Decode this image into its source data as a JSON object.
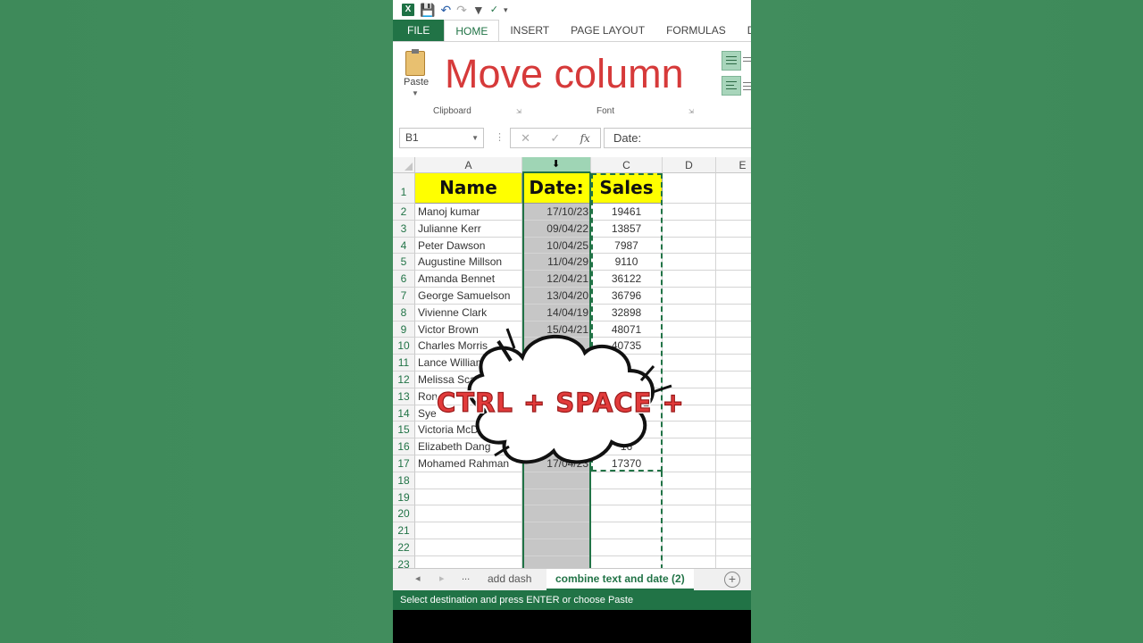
{
  "qat": {
    "logo": "X",
    "icons": [
      "save-icon",
      "undo-icon",
      "redo-icon",
      "filter-icon",
      "spellcheck-icon",
      "customize-icon"
    ]
  },
  "ribbon_tabs": [
    "FILE",
    "HOME",
    "INSERT",
    "PAGE LAYOUT",
    "FORMULAS",
    "DATA"
  ],
  "ribbon": {
    "paste_label": "Paste",
    "title": "Move column",
    "clipboard_label": "Clipboard",
    "font_label": "Font"
  },
  "formula_bar": {
    "name_box": "B1",
    "fx": "fx",
    "value": "Date:"
  },
  "columns": [
    "A",
    "B",
    "C",
    "D",
    "E"
  ],
  "rows": [
    "1",
    "2",
    "3",
    "4",
    "5",
    "6",
    "7",
    "8",
    "9",
    "10",
    "11",
    "12",
    "13",
    "14",
    "15",
    "16",
    "17",
    "18",
    "19",
    "20",
    "21",
    "22",
    "23"
  ],
  "headers": {
    "name": "Name",
    "date": "Date:",
    "sales": "Sales"
  },
  "data_rows": [
    {
      "name": "Manoj kumar",
      "date": "17/10/23",
      "sales": "19461"
    },
    {
      "name": "Julianne Kerr",
      "date": "09/04/22",
      "sales": "13857"
    },
    {
      "name": "Peter Dawson",
      "date": "10/04/25",
      "sales": "7987"
    },
    {
      "name": "Augustine Millson",
      "date": "11/04/29",
      "sales": "9110"
    },
    {
      "name": "Amanda Bennet",
      "date": "12/04/21",
      "sales": "36122"
    },
    {
      "name": "George Samuelson",
      "date": "13/04/20",
      "sales": "36796"
    },
    {
      "name": "Vivienne Clark",
      "date": "14/04/19",
      "sales": "32898"
    },
    {
      "name": "Victor Brown",
      "date": "15/04/21",
      "sales": "48071"
    },
    {
      "name": "Charles Morris",
      "date": "",
      "sales": "40735"
    },
    {
      "name": "Lance Williams",
      "date": "",
      "sales": ""
    },
    {
      "name": "Melissa Sca",
      "date": "",
      "sales": ""
    },
    {
      "name": "Ron T",
      "date": "",
      "sales": ""
    },
    {
      "name": "Sye",
      "date": "",
      "sales": ""
    },
    {
      "name": "Victoria McDo",
      "date": "",
      "sales": ""
    },
    {
      "name": "Elizabeth Dang",
      "date": "",
      "sales": "16"
    },
    {
      "name": "Mohamed Rahman",
      "date": "17/04/23",
      "sales": "17370"
    }
  ],
  "sheet_tabs": {
    "prev": "◂",
    "next": "▸",
    "more": "...",
    "tab1": "add dash",
    "tab2": "combine text and date (2)",
    "add": "+"
  },
  "status_bar": "Select destination and press ENTER or choose Paste",
  "overlay": {
    "text": "CTRL + SPACE +"
  }
}
